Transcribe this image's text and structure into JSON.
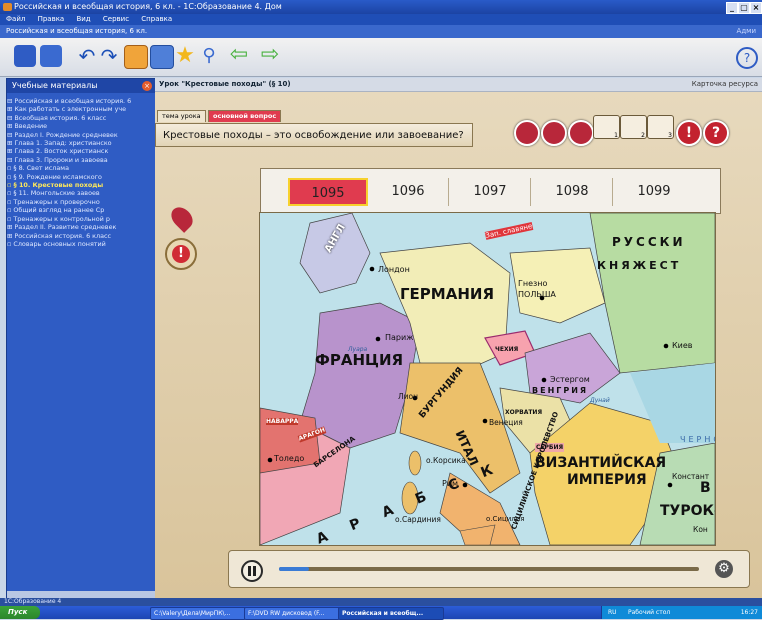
{
  "window": {
    "title": "Российская и всеобщая история, 6 кл. - 1С:Образование 4. Дом",
    "controls": [
      "_",
      "▢",
      "×"
    ]
  },
  "menu": [
    "Файл",
    "Правка",
    "Вид",
    "Сервис",
    "Справка"
  ],
  "subheader": {
    "left": "Российская и всеобщая история, 6 кл.",
    "right": "Адми"
  },
  "sidebar": {
    "title": "Учебные материалы",
    "tree": [
      "⊟ Российская и всеобщая история. 6",
      "   ⊞ Как работать с электронным уче",
      "   ⊟ Всеобщая история. 6 класс",
      "      ⊞ Введение",
      "      ⊟ Раздел I. Рождение средневек",
      "         ⊞ Глава 1. Запад: христианско",
      "         ⊞ Глава 2. Восток христианск",
      "         ⊟ Глава 3. Пророки и завоева",
      "            ▫ § 8. Свет ислама",
      "            ▫ § 9. Рождение исламского",
      "            ▫ § 10. Крестовые походы",
      "            ▫ § 11. Монгольские завоев",
      "            ▫ Тренажеры к проверочно",
      "         ▫ Общий взгляд на ранее Ср",
      "         ▫ Тренажеры к контрольной р",
      "      ⊞ Раздел II. Развитие средневек",
      "   ⊞ Российская история. 6 класс",
      "   ▫ Словарь основных понятий"
    ],
    "highlight_index": 10
  },
  "status_bar": "1С:Образование 4",
  "main": {
    "lesson_title": "Урок \"Крестовые походы\" (§ 10)",
    "resource_card": "Карточка ресурса",
    "tabs": [
      "тема урока",
      "основной вопрос"
    ],
    "question": "Крестовые походы – это освобождение или завоевание?",
    "years": [
      "1095",
      "1096",
      "1097",
      "1098",
      "1099"
    ],
    "selected_year": "1095",
    "scroll_numbers": [
      "1",
      "2",
      "3"
    ]
  },
  "map": {
    "countries": [
      "АНГЛ",
      "ГЕРМАНИЯ",
      "ФРАНЦИЯ",
      "РУССКИ",
      "КНЯЖЕСТ",
      "ПОЛЬША",
      "ЧЕХИЯ",
      "ВЕНГРИЯ",
      "БУРГУНДИЯ",
      "ИТАЛ",
      "ВИЗАНТИЙСКАЯ",
      "ИМПЕРИЯ",
      "ТУРОК-",
      "В",
      "СЕРБИЯ",
      "ХОРВАТИЯ",
      "НАВАРРА",
      "АРАГОН",
      "БАРСЕЛОНА",
      "СИЦИЛИЙСКОЕ КОРОЛЕВСТВО",
      "А Р А Б С К",
      "Зап. славяне",
      "ЧЕРНО"
    ],
    "cities": [
      "Лондон",
      "Париж",
      "Гнезно",
      "Киев",
      "Эстергом",
      "Лион",
      "Венеция",
      "Толедо",
      "о.Корсика",
      "Рим",
      "о.Сардиния",
      "о.Сицилия",
      "Констант",
      "Кон"
    ],
    "small": [
      "Луара",
      "Дунай"
    ]
  },
  "taskbar": {
    "start": "Пуск",
    "tasks": [
      "C:\\Valery\\Дела\\МирПК\\...",
      "F:\\DVD RW дисковод (F...",
      "Российская и всеобщ..."
    ],
    "tray_lang": "RU",
    "tray_desktop": "Рабочий стол",
    "time": "16:27"
  },
  "colors": {
    "accent_blue": "#2f5cc4",
    "year_selected": "#e03b4f",
    "parchment": "#e2d4b6"
  }
}
